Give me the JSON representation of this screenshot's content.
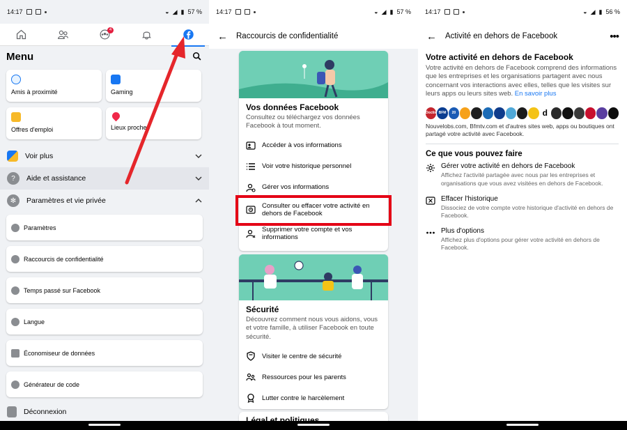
{
  "screen1": {
    "status": {
      "time": "14:17",
      "battery": "57 %"
    },
    "tabs": [
      "home",
      "friends",
      "groups",
      "notifications",
      "facebook"
    ],
    "groups_badge": "4",
    "menu_title": "Menu",
    "tiles": [
      {
        "label": "Amis à proximité",
        "color": "#1877f2"
      },
      {
        "label": "Gaming",
        "color": "#1877f2"
      },
      {
        "label": "Offres d'emploi",
        "color": "#f7b928"
      },
      {
        "label": "Lieux proches",
        "color": "#f02849"
      }
    ],
    "sections": [
      {
        "label": "Voir plus",
        "expanded": false
      },
      {
        "label": "Aide et assistance",
        "expanded": false
      },
      {
        "label": "Paramètres et vie privée",
        "expanded": true
      }
    ],
    "settings_items": [
      "Paramètres",
      "Raccourcis de confidentialité",
      "Temps passé sur Facebook",
      "Langue",
      "Économiseur de données",
      "Générateur de code"
    ],
    "logout": "Déconnexion",
    "arrow_color": "#e5262b"
  },
  "screen2": {
    "status": {
      "time": "14:17",
      "battery": "57 %"
    },
    "title": "Raccourcis de confidentialité",
    "card1": {
      "title": "Vos données Facebook",
      "desc": "Consultez ou téléchargez vos données Facebook à tout moment.",
      "items": [
        "Accéder à vos informations",
        "Voir votre historique personnel",
        "Gérer vos informations",
        "Consulter ou effacer votre activité en dehors de Facebook",
        "Supprimer votre compte et vos informations"
      ]
    },
    "card2": {
      "title": "Sécurité",
      "desc": "Découvrez comment nous vous aidons, vous et votre famille, à utiliser Facebook en toute sécurité.",
      "items": [
        "Visiter le centre de sécurité",
        "Ressources pour les parents",
        "Lutter contre le harcèlement"
      ]
    },
    "card3_title": "Légal et politiques",
    "highlight_color": "#e40015"
  },
  "screen3": {
    "status": {
      "time": "14:17",
      "battery": "56 %"
    },
    "title": "Activité en dehors de Facebook",
    "heading": "Votre activité en dehors de Facebook",
    "intro": "Votre activité en dehors de Facebook comprend des informations que les entreprises et les organisations partagent avec nous concernant vos interactions avec elles, telles que les visites sur leurs apps ou leurs sites web.",
    "learn_more": "En savoir plus",
    "logos_caption": "Nouvelobs.com, Bfmtv.com et d'autres sites web, apps ou boutiques ont partagé votre activité avec Facebook.",
    "section_title": "Ce que vous pouvez faire",
    "options": [
      {
        "title": "Gérer votre activité en dehors de Facebook",
        "desc": "Affichez l'activité partagée avec nous par les entreprises et organisations que vous avez visitées en dehors de Facebook.",
        "icon": "gear-icon"
      },
      {
        "title": "Effacer l'historique",
        "desc": "Dissociez de votre compte votre historique d'activité en dehors de Facebook.",
        "icon": "clear-icon"
      },
      {
        "title": "Plus d'options",
        "desc": "Affichez plus d'options pour gérer votre activité en dehors de Facebook.",
        "icon": "more-icon"
      }
    ],
    "logos": [
      {
        "text": "Doctis",
        "color": "#c4262e"
      },
      {
        "text": "BFM",
        "color": "#0a3d91"
      },
      {
        "text": "20",
        "color": "#1a5bb5"
      },
      {
        "text": "",
        "color": "#f6a11a"
      },
      {
        "text": "",
        "color": "#1e1e1e"
      },
      {
        "text": "",
        "color": "#1b6bb6"
      },
      {
        "text": "",
        "color": "#0f3c8c"
      },
      {
        "text": "",
        "color": "#4fa8d8"
      },
      {
        "text": "",
        "color": "#1b1b1b"
      },
      {
        "text": "",
        "color": "#f4c316"
      },
      {
        "text": "d",
        "color": "#ffffff"
      },
      {
        "text": "",
        "color": "#2a2a2a"
      },
      {
        "text": "",
        "color": "#101010"
      },
      {
        "text": "",
        "color": "#3a3a3a"
      },
      {
        "text": "",
        "color": "#c8102e"
      },
      {
        "text": "",
        "color": "#5a3ea0"
      },
      {
        "text": "",
        "color": "#0d0d0d"
      }
    ]
  }
}
